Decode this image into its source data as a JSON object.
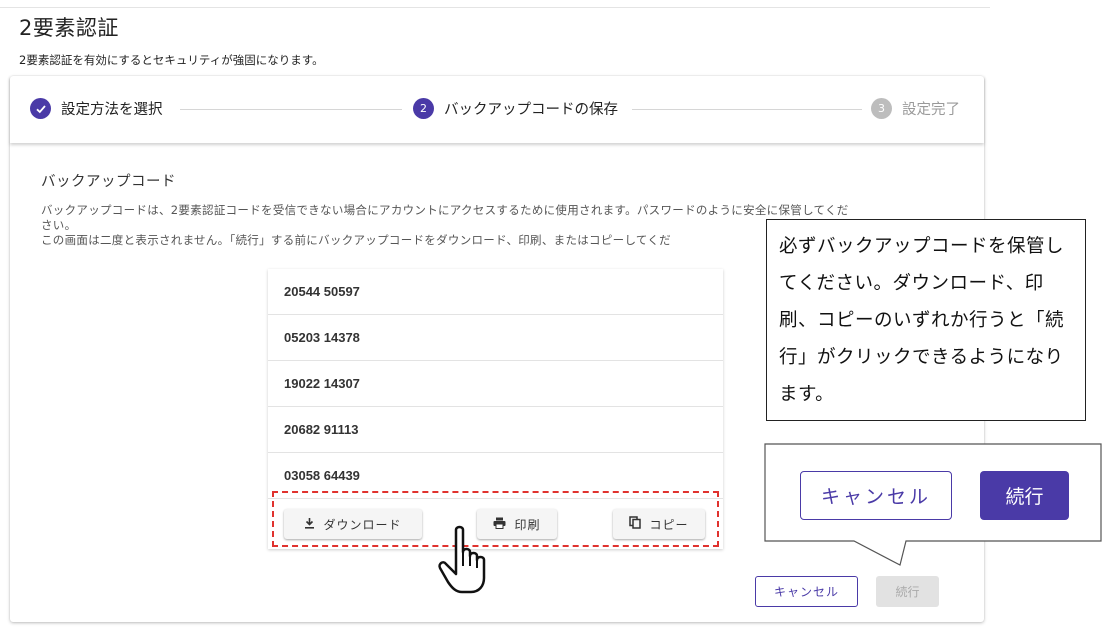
{
  "page": {
    "title": "2要素認証",
    "subtitle": "2要素認証を有効にするとセキュリティが強固になります。"
  },
  "stepper": {
    "steps": [
      {
        "number": "✓",
        "label": "設定方法を選択",
        "state": "completed"
      },
      {
        "number": "2",
        "label": "バックアップコードの保存",
        "state": "active"
      },
      {
        "number": "3",
        "label": "設定完了",
        "state": "pending"
      }
    ]
  },
  "backup": {
    "heading": "バックアップコード",
    "description_line1": "バックアップコードは、2要素認証コードを受信できない場合にアカウントにアクセスするために使用されます。パスワードのように安全に保管してくだ",
    "description_line2": "さい。",
    "description_line3": "この画面は二度と表示されません。「続行」する前にバックアップコードをダウンロード、印刷、またはコピーしてくだ",
    "codes": [
      "20544 50597",
      "05203 14378",
      "19022 14307",
      "20682 91113",
      "03058 64439"
    ],
    "download_label": "ダウンロード",
    "print_label": "印刷",
    "copy_label": "コピー"
  },
  "footer": {
    "cancel_label": "キャンセル",
    "continue_label": "続行"
  },
  "callout": {
    "text": "必ずバックアップコードを保管してください。ダウンロード、印刷、コピーのいずれか行うと「続行」がクリックできるようになります。",
    "cancel_label": "キャンセル",
    "continue_label": "続行"
  },
  "colors": {
    "accent": "#4a3aa7",
    "highlight": "#e0322e",
    "disabled": "#e2e2e2"
  },
  "icons": {
    "download": "download-icon",
    "print": "printer-icon",
    "copy": "copy-icon",
    "check": "check-icon",
    "cursor": "hand-pointer-icon"
  }
}
